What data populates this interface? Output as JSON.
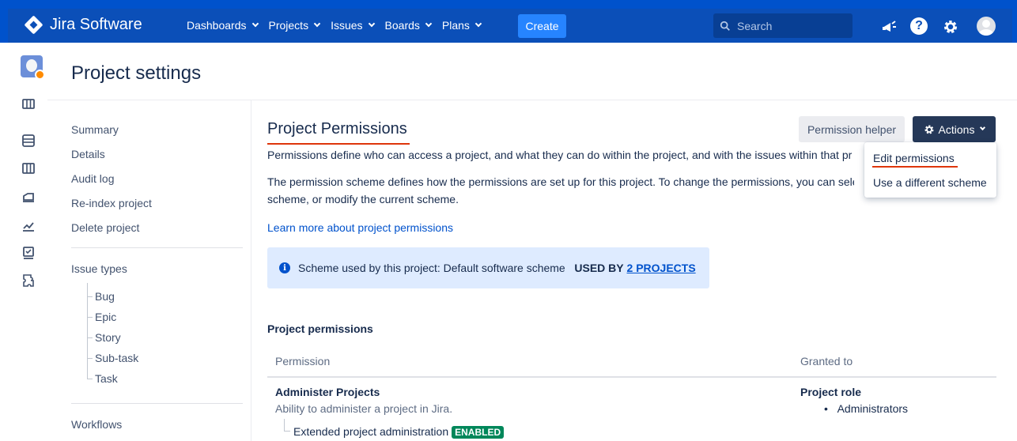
{
  "topnav": {
    "product": "Jira Software",
    "menu": [
      "Dashboards",
      "Projects",
      "Issues",
      "Boards",
      "Plans"
    ],
    "create_label": "Create",
    "search_placeholder": "Search"
  },
  "page": {
    "title": "Project settings"
  },
  "sidebar": {
    "items": [
      "Summary",
      "Details",
      "Audit log",
      "Re-index project",
      "Delete project"
    ],
    "issue_types_heading": "Issue types",
    "issue_types": [
      "Bug",
      "Epic",
      "Story",
      "Sub-task",
      "Task"
    ],
    "workflows": "Workflows"
  },
  "main": {
    "heading": "Project Permissions",
    "para1": "Permissions define who can access a project, and what they can do within the project, and with the issues within that pr",
    "para2a": "The permission scheme defines how the permissions are set up for this project. To change the permissions, you can sele",
    "para2b": "scheme, or modify the current scheme.",
    "learn_more": "Learn more about project permissions",
    "permission_helper": "Permission helper",
    "actions_label": "Actions",
    "actions_menu": [
      "Edit permissions",
      "Use a different scheme"
    ],
    "scheme_prefix": "Scheme used by this project: Default software scheme",
    "used_by_label": "USED BY",
    "used_by_link": "2 PROJECTS",
    "subheading": "Project permissions",
    "table": {
      "headers": [
        "Permission",
        "Granted to"
      ],
      "rows": [
        {
          "name": "Administer Projects",
          "desc": "Ability to administer a project in Jira.",
          "granted_type": "Project role",
          "granted_value": "Administrators",
          "extended": "Extended project administration",
          "extended_badge": "ENABLED"
        }
      ]
    }
  },
  "colors": {
    "nav": "#0b4fb8",
    "accent": "#0052cc",
    "actions": "#253858",
    "annotation": "#de350b",
    "badge": "#00875a"
  }
}
